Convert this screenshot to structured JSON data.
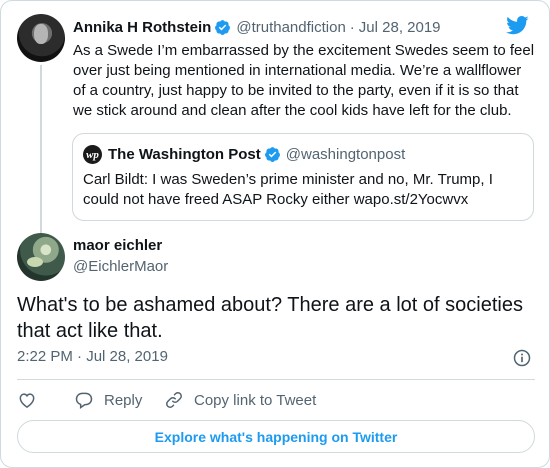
{
  "parent_tweet": {
    "name": "Annika H Rothstein",
    "handle": "@truthandfiction",
    "separator": "·",
    "date": "Jul 28, 2019",
    "text": "As a Swede I’m embarrassed by the excitement Swedes seem to feel over just being mentioned in international media. We’re a wallflower of a country, just happy to be invited to the party, even if it is so that we stick around and clean after the cool kids have left for the club."
  },
  "quoted_tweet": {
    "logo_text": "wp",
    "name": "The Washington Post",
    "handle": "@washingtonpost",
    "text": "Carl Bildt: I was Sweden’s prime minister and no, Mr. Trump, I could not have freed ASAP Rocky either wapo.st/2Yocwvx"
  },
  "main_tweet": {
    "name": "maor eichler",
    "handle": "@EichlerMaor",
    "text": "What's to be ashamed about? There are a lot of societies that act like that.",
    "timestamp": "2:22 PM · Jul 28, 2019"
  },
  "actions": {
    "like_icon": "heart-icon",
    "reply_label": "Reply",
    "copy_label": "Copy link to Tweet"
  },
  "footer": {
    "explore_label": "Explore what's happening on Twitter"
  },
  "colors": {
    "accent": "#1d9bf0",
    "text": "#0f1419",
    "muted": "#536471",
    "border": "#cfd9de"
  }
}
